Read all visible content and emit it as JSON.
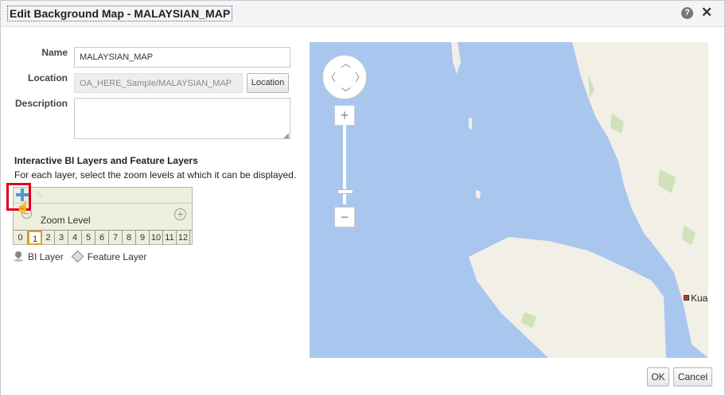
{
  "dialog": {
    "title": "Edit Background Map - MALAYSIAN_MAP",
    "help_glyph": "?",
    "close_glyph": "✕"
  },
  "form": {
    "name_label": "Name",
    "name_value": "MALAYSIAN_MAP",
    "location_label": "Location",
    "location_value": "OA_HERE_Sample/MALAYSIAN_MAP",
    "location_button": "Location",
    "description_label": "Description",
    "description_value": ""
  },
  "layers": {
    "title": "Interactive BI Layers and Feature Layers",
    "description": "For each layer, select the zoom levels at which it can be displayed.",
    "zoom_caption": "Zoom Level",
    "zoom_levels": [
      "0",
      "1",
      "2",
      "3",
      "4",
      "5",
      "6",
      "7",
      "8",
      "9",
      "10",
      "11",
      "12"
    ],
    "selected_zoom": "1",
    "legend_bi": "BI Layer",
    "legend_feature": "Feature Layer"
  },
  "map": {
    "city_label": "Kua",
    "water_color": "#a9c6ef",
    "land_color": "#f1efe6",
    "park_color": "#cfe2b8"
  },
  "footer": {
    "ok": "OK",
    "cancel": "Cancel"
  }
}
